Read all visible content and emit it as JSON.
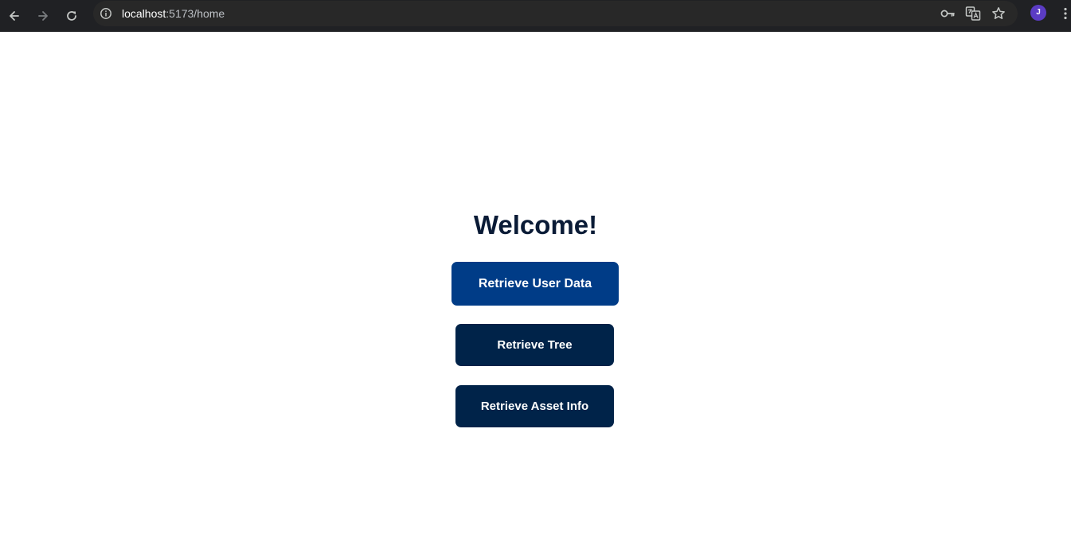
{
  "browser": {
    "url_host": "localhost",
    "url_path": ":5173/home",
    "avatar_initial": "J",
    "icons": {
      "back": "arrow-left-icon",
      "forward": "arrow-right-icon",
      "reload": "reload-icon",
      "site_info": "info-icon",
      "password": "key-icon",
      "translate": "translate-icon",
      "bookmark": "star-icon",
      "menu": "kebab-menu-icon"
    }
  },
  "page": {
    "heading": "Welcome!",
    "buttons": {
      "user_data": "Retrieve User Data",
      "tree": "Retrieve Tree",
      "asset_info": "Retrieve Asset Info"
    }
  },
  "colors": {
    "toolbar_bg": "#202124",
    "heading": "#0a1b36",
    "primary_button": "#003c87",
    "secondary_button": "#002349",
    "avatar": "#5b3cc4"
  }
}
